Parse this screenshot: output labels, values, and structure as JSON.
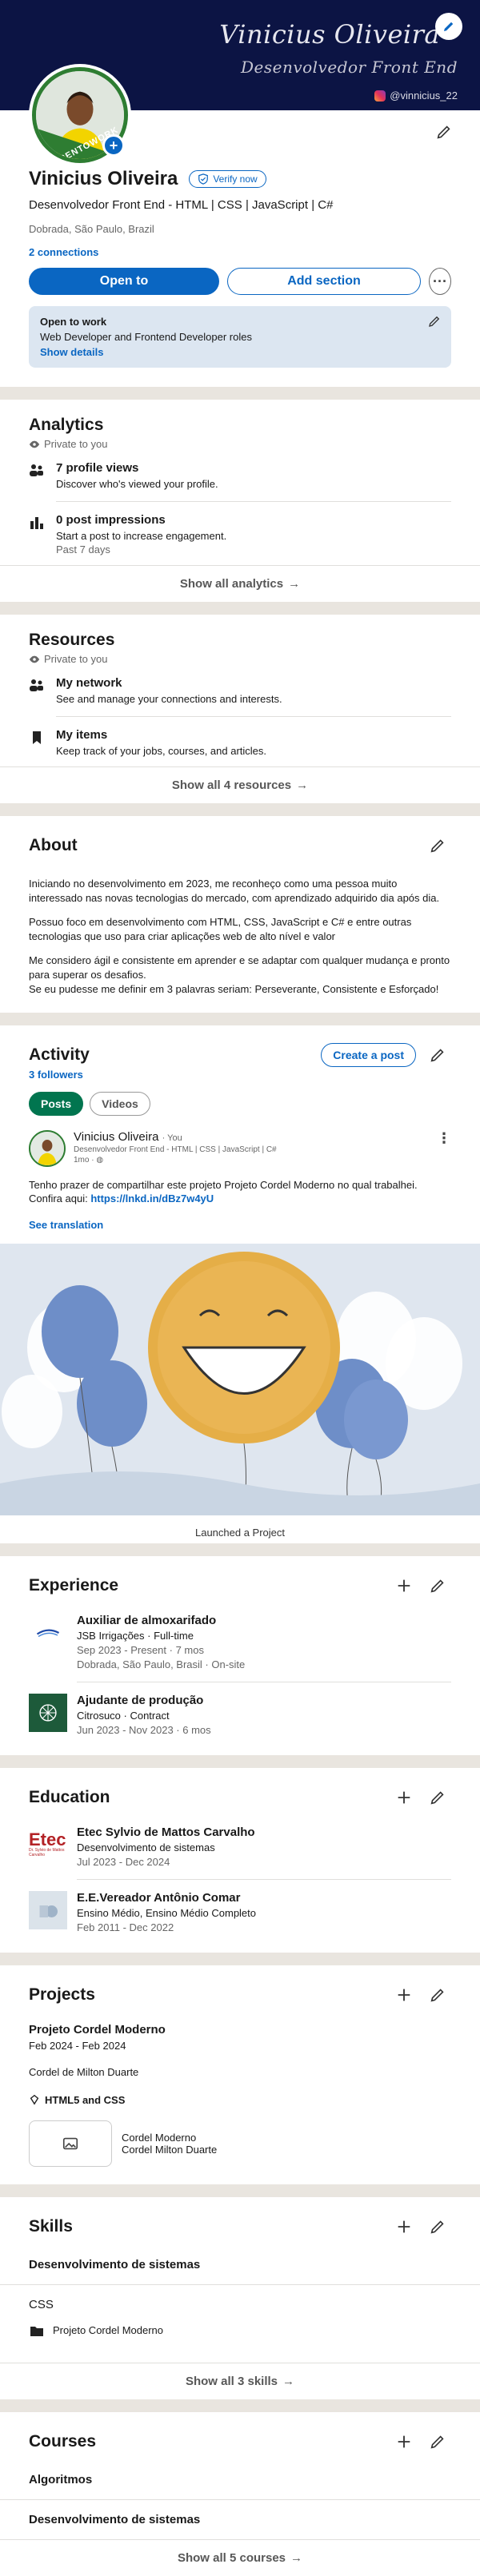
{
  "banner": {
    "script_name": "Vinicius Oliveira",
    "script_role": "Desenvolvedor  Front End",
    "instagram": "@vinnicius_22"
  },
  "avatar": {
    "badge_text": "#OPENTOWORK"
  },
  "profile": {
    "name": "Vinicius Oliveira",
    "verify_label": "Verify now",
    "headline": "Desenvolvedor Front End - HTML | CSS | JavaScript | C#",
    "location": "Dobrada, São Paulo, Brazil",
    "connections": "2 connections",
    "open_to_label": "Open to",
    "add_section_label": "Add section",
    "more_label": "···",
    "open_to_work": {
      "title": "Open to work",
      "desc": "Web Developer and Frontend Developer roles",
      "link": "Show details"
    }
  },
  "analytics": {
    "title": "Analytics",
    "private": "Private to you",
    "items": [
      {
        "title": "7 profile views",
        "desc": "Discover who's viewed your profile.",
        "sub": ""
      },
      {
        "title": "0 post impressions",
        "desc": "Start a post to increase engagement.",
        "sub": "Past 7 days"
      }
    ],
    "show_all": "Show all analytics"
  },
  "resources": {
    "title": "Resources",
    "private": "Private to you",
    "items": [
      {
        "title": "My network",
        "desc": "See and manage your connections and interests."
      },
      {
        "title": "My items",
        "desc": "Keep track of your jobs, courses, and articles."
      }
    ],
    "show_all": "Show all 4 resources"
  },
  "about": {
    "title": "About",
    "p1": "Iniciando no desenvolvimento em 2023, me reconheço como uma pessoa muito interessado nas novas tecnologias do mercado, com aprendizado adquirido dia após dia.",
    "p2": "Possuo foco em desenvolvimento com HTML, CSS, JavaScript e C# e entre outras tecnologias que uso para criar aplicações web de alto nível  e valor",
    "p3a": "Me considero ágil e consistente em aprender e se adaptar com qualquer mudança e pronto para superar os desafios.",
    "p3b": "Se eu pudesse me definir em 3 palavras seriam: Perseverante, Consistente e Esforçado!"
  },
  "activity": {
    "title": "Activity",
    "followers": "3 followers",
    "create_post": "Create a post",
    "tabs": [
      "Posts",
      "Videos"
    ],
    "post": {
      "author": "Vinicius Oliveira",
      "you": "· You",
      "subtitle": "Desenvolvedor Front End - HTML | CSS | JavaScript | C#",
      "time": "1mo · ◍",
      "more": "⋮",
      "text": "Tenho prazer de compartilhar este projeto Projeto Cordel Moderno no qual trabalhei. Confira aqui: ",
      "link": "https://lnkd.in/dBz7w4yU",
      "see_translation": "See translation",
      "caption": "Launched a Project"
    }
  },
  "experience": {
    "title": "Experience",
    "items": [
      {
        "title": "Auxiliar de  almoxarifado",
        "company": "JSB Irrigações · Full-time",
        "dates": "Sep 2023 - Present · 7 mos",
        "location": "Dobrada, São Paulo, Brasil · On-site"
      },
      {
        "title": "Ajudante de produção",
        "company": "Citrosuco · Contract",
        "dates": "Jun 2023 - Nov 2023 · 6 mos",
        "location": ""
      }
    ]
  },
  "education": {
    "title": "Education",
    "items": [
      {
        "logo_text": "Etec",
        "logo_sub": "Dr. Sylvio de Mattos Carvalho",
        "school": "Etec Sylvio de Mattos Carvalho",
        "degree": "Desenvolvimento de sistemas",
        "dates": "Jul 2023 - Dec 2024"
      },
      {
        "logo_text": "",
        "logo_sub": "",
        "school": "E.E.Vereador Antônio Comar",
        "degree": "Ensino Médio, Ensino Médio Completo",
        "dates": "Feb 2011 - Dec 2022"
      }
    ]
  },
  "projects": {
    "title": "Projects",
    "name": "Projeto Cordel Moderno",
    "dates": "Feb 2024 - Feb 2024",
    "desc": "Cordel de Milton Duarte",
    "skills": "HTML5 and CSS",
    "media_title": "Cordel Moderno",
    "media_sub": "Cordel Milton Duarte"
  },
  "skills": {
    "title": "Skills",
    "items": [
      {
        "name": "Desenvolvimento de sistemas",
        "sub": ""
      },
      {
        "name": "CSS",
        "sub": "Projeto Cordel Moderno"
      }
    ],
    "show_all": "Show all 3 skills"
  },
  "courses": {
    "title": "Courses",
    "items": [
      "Algoritmos",
      "Desenvolvimento de sistemas"
    ],
    "show_all": "Show all 5 courses"
  },
  "colors": {
    "accent": "#0a66c2",
    "open_to_work_green": "#01754f",
    "banner": "#0c1444",
    "page_bg": "#e9e5df"
  }
}
